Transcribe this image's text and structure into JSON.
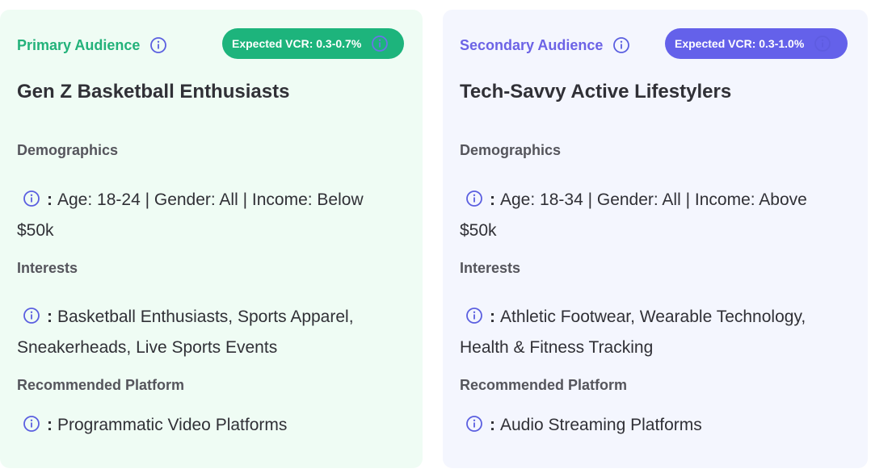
{
  "cards": [
    {
      "audience_label": "Primary Audience",
      "vcr": "Expected VCR: 0.3-0.7%",
      "title": "Gen Z Basketball Enthusiasts",
      "demographics_label": "Demographics",
      "demographics": "Age: 18-24 | Gender: All | Income: Below $50k",
      "interests_label": "Interests",
      "interests": "Basketball Enthusiasts, Sports Apparel, Sneakerheads, Live Sports Events",
      "platform_label": "Recommended Platform",
      "platform": "Programmatic Video Platforms",
      "colon": ":"
    },
    {
      "audience_label": "Secondary Audience",
      "vcr": "Expected VCR: 0.3-1.0%",
      "title": "Tech-Savvy Active Lifestylers",
      "demographics_label": "Demographics",
      "demographics": "Age: 18-34 | Gender: All | Income: Above $50k",
      "interests_label": "Interests",
      "interests": "Athletic Footwear, Wearable Technology, Health & Fitness Tracking",
      "platform_label": "Recommended Platform",
      "platform": "Audio Streaming Platforms",
      "colon": ":"
    }
  ],
  "icons": {
    "info": "info-icon"
  },
  "colors": {
    "primary_accent": "#1db47c",
    "secondary_accent": "#6461ea",
    "primary_bg": "#effcf4",
    "secondary_bg": "#f4f6fe"
  }
}
